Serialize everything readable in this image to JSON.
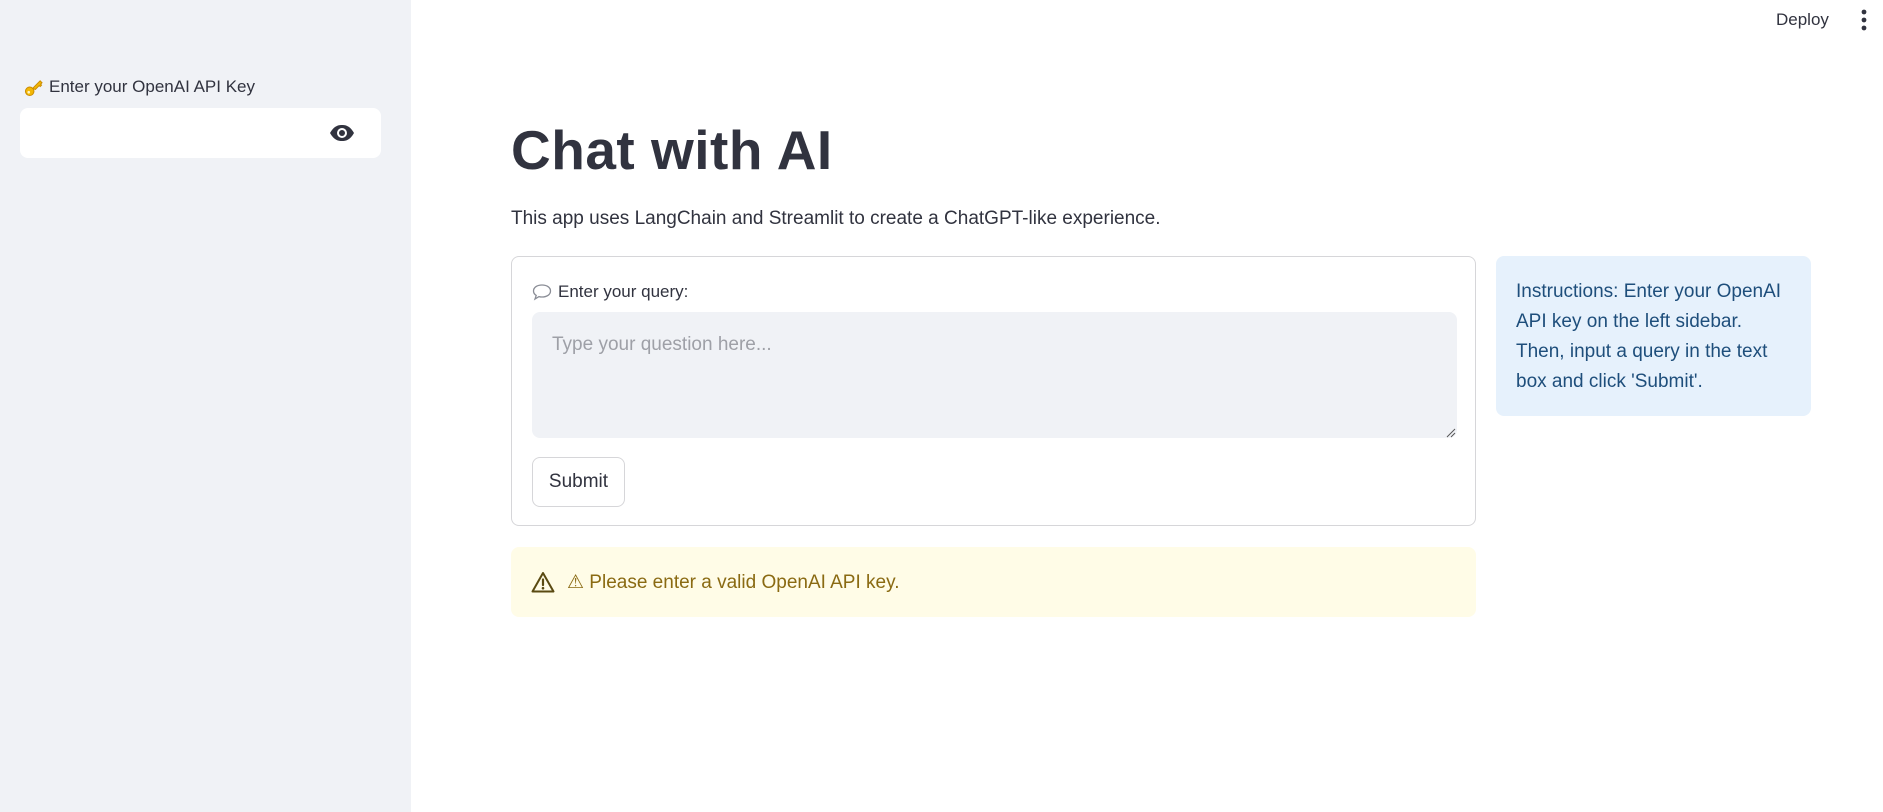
{
  "sidebar": {
    "api_key_label": "Enter your OpenAI API Key",
    "api_key_icon": "key-icon",
    "api_key_value": "",
    "toggle_visibility_icon": "eye-icon"
  },
  "header": {
    "deploy_label": "Deploy",
    "menu_icon": "more-vertical-icon"
  },
  "main": {
    "title": "Chat with AI",
    "subtitle": "This app uses LangChain and Streamlit to create a ChatGPT-like experience.",
    "form": {
      "query_label": "Enter your query:",
      "query_icon": "speech-bubble-icon",
      "query_placeholder": "Type your question here...",
      "query_value": "",
      "submit_label": "Submit"
    },
    "info": {
      "text": "Instructions: Enter your OpenAI API key on the left sidebar. Then, input a query in the text box and click 'Submit'."
    },
    "warning": {
      "icon": "warning-icon",
      "text": "⚠ Please enter a valid OpenAI API key."
    }
  },
  "colors": {
    "sidebar_bg": "#f0f2f6",
    "info_bg": "#e6f1fc",
    "info_text": "#1e4e7b",
    "warning_bg": "#fffce7",
    "warning_text": "#8a6a12",
    "text": "#31333f"
  }
}
